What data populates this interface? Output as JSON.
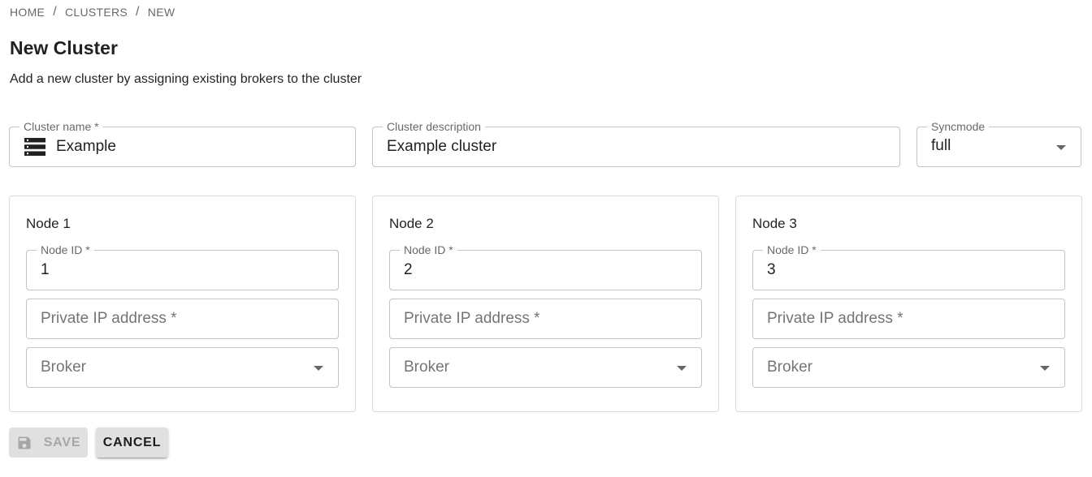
{
  "breadcrumb": {
    "items": [
      {
        "label": "HOME"
      },
      {
        "label": "CLUSTERS"
      },
      {
        "label": "NEW"
      }
    ],
    "separator": "/"
  },
  "page": {
    "title": "New Cluster",
    "subtitle": "Add a new cluster by assigning existing brokers to the cluster"
  },
  "cluster_form": {
    "name": {
      "label": "Cluster name *",
      "value": "Example",
      "icon": "server-icon"
    },
    "description": {
      "label": "Cluster description",
      "value": "Example cluster"
    },
    "syncmode": {
      "label": "Syncmode",
      "value": "full"
    }
  },
  "nodes": [
    {
      "title": "Node 1",
      "node_id_label": "Node ID *",
      "node_id_value": "1",
      "ip_placeholder": "Private IP address *",
      "broker_placeholder": "Broker"
    },
    {
      "title": "Node 2",
      "node_id_label": "Node ID *",
      "node_id_value": "2",
      "ip_placeholder": "Private IP address *",
      "broker_placeholder": "Broker"
    },
    {
      "title": "Node 3",
      "node_id_label": "Node ID *",
      "node_id_value": "3",
      "ip_placeholder": "Private IP address *",
      "broker_placeholder": "Broker"
    }
  ],
  "actions": {
    "save_label": "Save",
    "save_icon": "save-icon",
    "save_disabled": true,
    "cancel_label": "Cancel"
  }
}
